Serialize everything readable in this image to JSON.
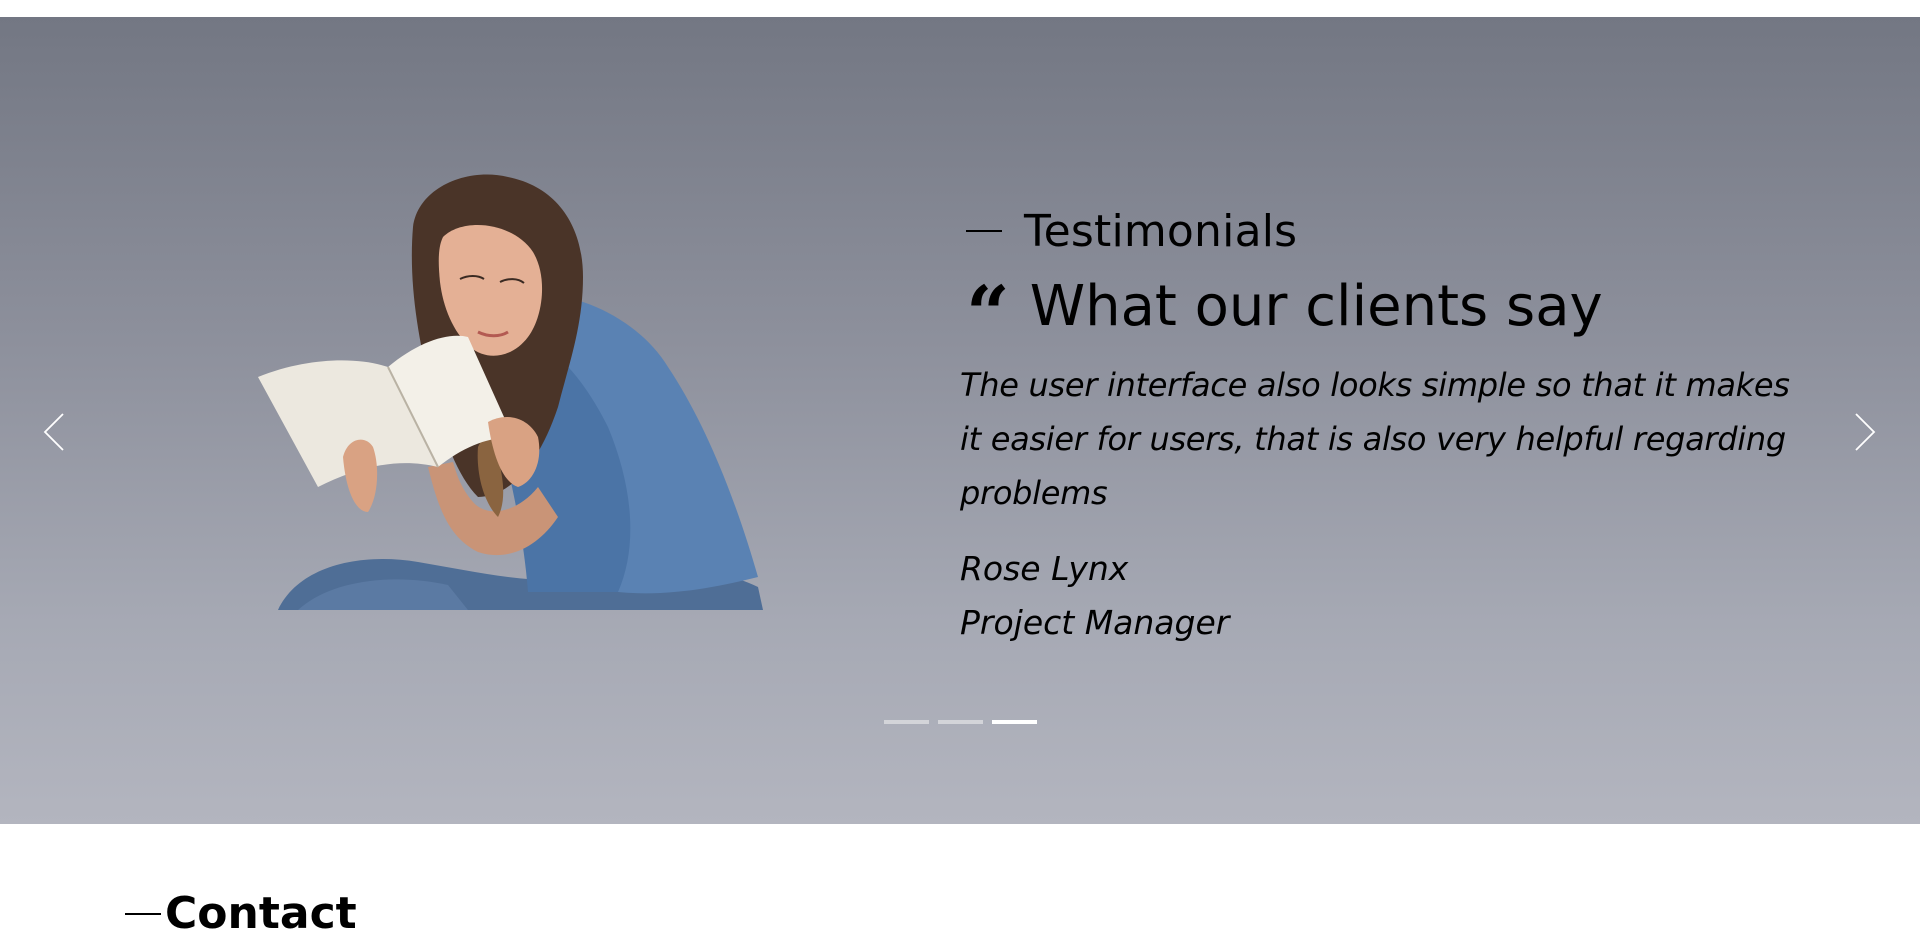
{
  "testimonials": {
    "eyebrow": "Testimonials",
    "heading": "What our clients say",
    "quote_mark": "“",
    "quote": "The user interface also looks simple so that it makes it easier for users, that is also very helpful regarding problems",
    "author_name": "Rose Lynx",
    "author_role": "Project Manager",
    "carousel": {
      "slide_count": 3,
      "active_slide": 3,
      "prev_icon": "chevron-left-icon",
      "next_icon": "chevron-right-icon"
    }
  },
  "contact": {
    "heading": "Contact"
  },
  "colors": {
    "section_top": "#737783",
    "section_bottom": "#b3b5bf",
    "dot_inactive": "#d3d4d9",
    "dot_active": "#ffffff"
  }
}
